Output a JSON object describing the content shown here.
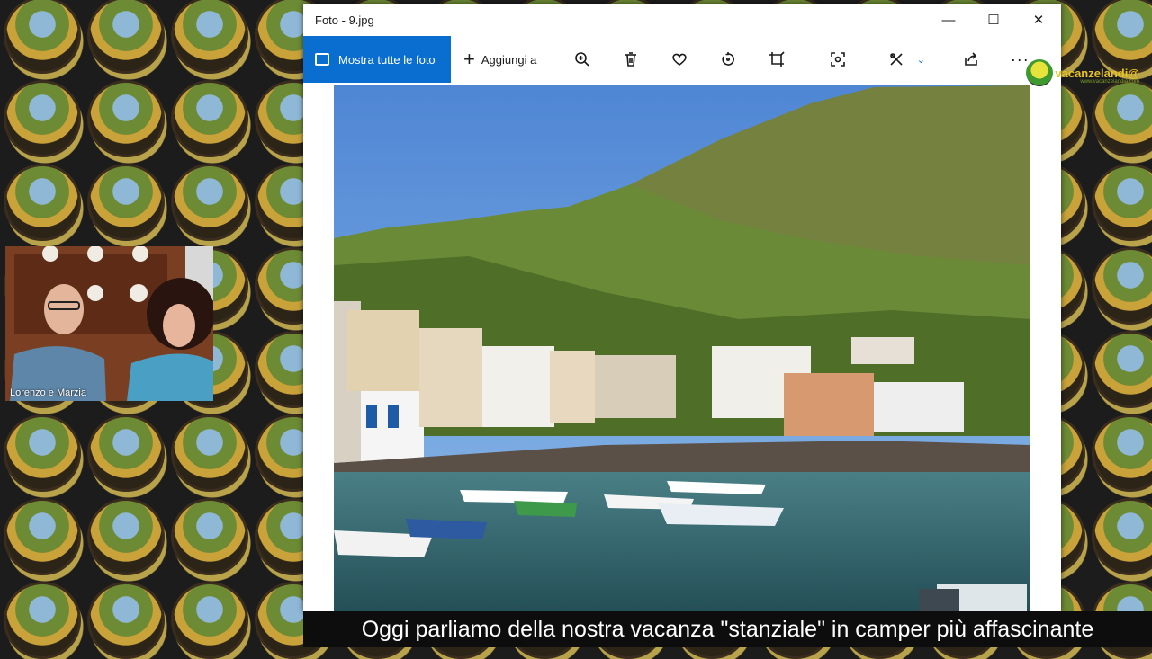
{
  "window": {
    "title": "Foto - 9.jpg",
    "minimize_glyph": "—",
    "maximize_glyph": "☐",
    "close_glyph": "✕"
  },
  "toolbar": {
    "show_all_label": "Mostra tutte le foto",
    "add_to_label": "Aggiungi a",
    "more_glyph": "···",
    "icons": [
      "zoom-in-icon",
      "delete-icon",
      "favorite-icon",
      "rotate-icon",
      "crop-icon",
      "enhance-icon",
      "edit-icon",
      "share-icon",
      "more-icon"
    ]
  },
  "logo": {
    "text": "vacanzelandi@",
    "subtext": "www.vacanzelandia.com"
  },
  "webcam": {
    "name": "Lorenzo e Marzia"
  },
  "subtitle": {
    "text": "Oggi parliamo della nostra vacanza \"stanziale\" in camper più affascinante"
  },
  "colors": {
    "accent": "#0a6ed1",
    "sky": "#6fa3dd",
    "hill": "#5d7a2e",
    "sea": "#3d6a6e"
  }
}
